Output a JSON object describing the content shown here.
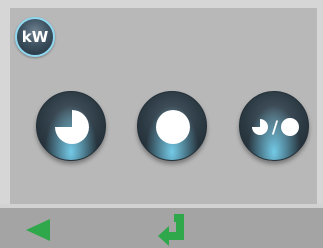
{
  "header": {
    "unit_label": "kW",
    "unit_icon": "kw-unit-icon"
  },
  "buttons": [
    {
      "icon": "partial-load-pie-icon",
      "fill_fraction": 0.75
    },
    {
      "icon": "full-load-circle-icon",
      "fill_fraction": 1.0
    },
    {
      "icon": "partial-full-load-toggle-icon",
      "separator": "/"
    }
  ],
  "nav": [
    {
      "icon": "back-arrow-icon"
    },
    {
      "icon": "enter-return-icon"
    }
  ],
  "colors": {
    "panel": "#b8b8b8",
    "nav_bar": "#a4a4a4",
    "button_glow": "#78d2f0",
    "nav_green": "#2ea84a",
    "icon_white": "#ffffff"
  }
}
